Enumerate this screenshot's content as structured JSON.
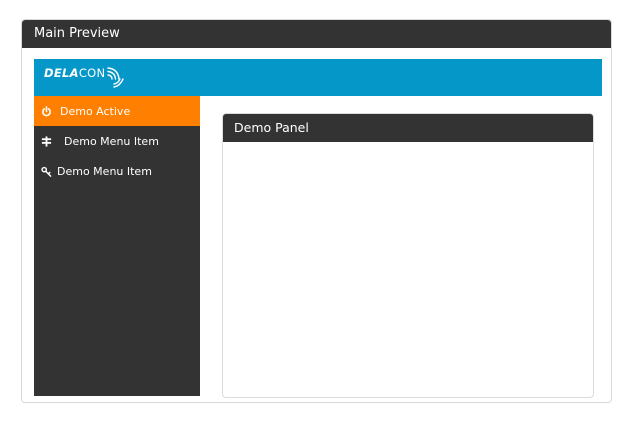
{
  "window": {
    "title": "Main Preview"
  },
  "brand": {
    "logo_bold": "DELA",
    "logo_light": "CON",
    "logo_icon": "signal-waves-icon",
    "color": "#0697c9"
  },
  "sidebar": {
    "items": [
      {
        "label": "Demo Active",
        "icon": "power-icon",
        "active": true
      },
      {
        "label": "Demo Menu Item",
        "icon": "signpost-icon",
        "active": false
      },
      {
        "label": "Demo Menu Item",
        "icon": "key-icon",
        "active": false
      }
    ],
    "active_color": "#ff7f00",
    "background": "#333333"
  },
  "panel": {
    "title": "Demo Panel"
  }
}
